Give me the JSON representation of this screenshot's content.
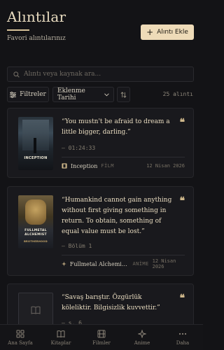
{
  "header": {
    "title": "Alıntılar",
    "subtitle": "Favori alıntılarınız",
    "add_button": "Alıntı Ekle"
  },
  "search": {
    "placeholder": "Alıntı veya kaynak ara..."
  },
  "filters": {
    "filter_label": "Filtreler",
    "sort_selected": "Eklenme Tarihi",
    "count": "25 alıntı"
  },
  "quotes": [
    {
      "text": "“You mustn't be afraid to dream a little bigger, darling.”",
      "location": "— 01:24:33",
      "source": "Inception",
      "type": "FİLM",
      "date": "12 Nisan 2026",
      "poster_title": "INCEPTION"
    },
    {
      "text": "“Humankind cannot gain anything without first giving something in return. To obtain, something of equal value must be lost.”",
      "location": "— Bölüm 1",
      "source": "Fullmetal Alchemist: B...",
      "type": "ANİME",
      "date": "12 Nisan 2026",
      "poster_title": "FULLMETAL ALCHEMIST",
      "poster_subtitle": "BROTHERHOOD"
    },
    {
      "text": "“Savaş barıştır. Özgürlük köleliktir. Bilgisizlik kuvvettir.”",
      "location": "— s. 6"
    }
  ],
  "nav": [
    {
      "label": "Ana Sayfa",
      "icon": "grid-icon"
    },
    {
      "label": "Kitaplar",
      "icon": "book-icon"
    },
    {
      "label": "Filmler",
      "icon": "film-icon"
    },
    {
      "label": "Anime",
      "icon": "sparkle-icon"
    },
    {
      "label": "Daha",
      "icon": "more-icon"
    }
  ],
  "colors": {
    "accent": "#eedbb8",
    "background": "#131316",
    "card": "#19191d"
  }
}
